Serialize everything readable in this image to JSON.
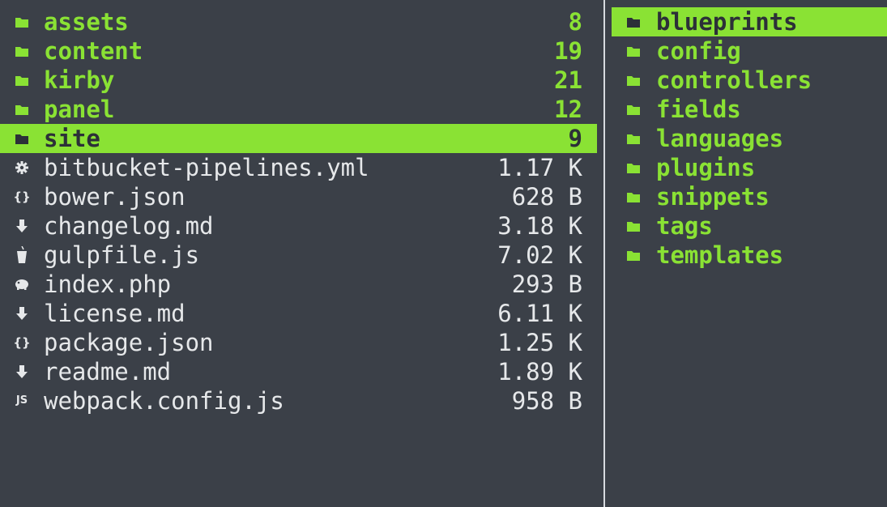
{
  "left_pane": {
    "items": [
      {
        "name": "assets",
        "size": "8",
        "type": "dir",
        "icon": "folder-icon",
        "selected": false
      },
      {
        "name": "content",
        "size": "19",
        "type": "dir",
        "icon": "folder-icon",
        "selected": false
      },
      {
        "name": "kirby",
        "size": "21",
        "type": "dir",
        "icon": "folder-icon",
        "selected": false
      },
      {
        "name": "panel",
        "size": "12",
        "type": "dir",
        "icon": "folder-icon",
        "selected": false
      },
      {
        "name": "site",
        "size": "9",
        "type": "dir",
        "icon": "folder-icon",
        "selected": true
      },
      {
        "name": "bitbucket-pipelines.yml",
        "size": "1.17 K",
        "type": "file",
        "icon": "gear-icon",
        "selected": false
      },
      {
        "name": "bower.json",
        "size": "628 B",
        "type": "file",
        "icon": "json-braces-icon",
        "selected": false
      },
      {
        "name": "changelog.md",
        "size": "3.18 K",
        "type": "file",
        "icon": "markdown-down-arrow-icon",
        "selected": false
      },
      {
        "name": "gulpfile.js",
        "size": "7.02 K",
        "type": "file",
        "icon": "gulp-cup-icon",
        "selected": false
      },
      {
        "name": "index.php",
        "size": "293 B",
        "type": "file",
        "icon": "php-elephant-icon",
        "selected": false
      },
      {
        "name": "license.md",
        "size": "6.11 K",
        "type": "file",
        "icon": "markdown-down-arrow-icon",
        "selected": false
      },
      {
        "name": "package.json",
        "size": "1.25 K",
        "type": "file",
        "icon": "json-braces-icon",
        "selected": false
      },
      {
        "name": "readme.md",
        "size": "1.89 K",
        "type": "file",
        "icon": "markdown-down-arrow-icon",
        "selected": false
      },
      {
        "name": "webpack.config.js",
        "size": "958 B",
        "type": "file",
        "icon": "js-icon",
        "selected": false
      }
    ]
  },
  "right_pane": {
    "items": [
      {
        "name": "blueprints",
        "type": "dir",
        "icon": "folder-icon",
        "selected": true
      },
      {
        "name": "config",
        "type": "dir",
        "icon": "folder-icon",
        "selected": false
      },
      {
        "name": "controllers",
        "type": "dir",
        "icon": "folder-icon",
        "selected": false
      },
      {
        "name": "fields",
        "type": "dir",
        "icon": "folder-icon",
        "selected": false
      },
      {
        "name": "languages",
        "type": "dir",
        "icon": "folder-icon",
        "selected": false
      },
      {
        "name": "plugins",
        "type": "dir",
        "icon": "folder-icon",
        "selected": false
      },
      {
        "name": "snippets",
        "type": "dir",
        "icon": "folder-icon",
        "selected": false
      },
      {
        "name": "tags",
        "type": "dir",
        "icon": "folder-icon",
        "selected": false
      },
      {
        "name": "templates",
        "type": "dir",
        "icon": "folder-icon",
        "selected": false
      }
    ]
  },
  "colors": {
    "background": "#3b4048",
    "directory": "#8ae234",
    "selection_bg": "#8ae234",
    "selection_fg": "#2c3038",
    "file_text": "#e6e8ea",
    "divider": "#d7dadf"
  }
}
